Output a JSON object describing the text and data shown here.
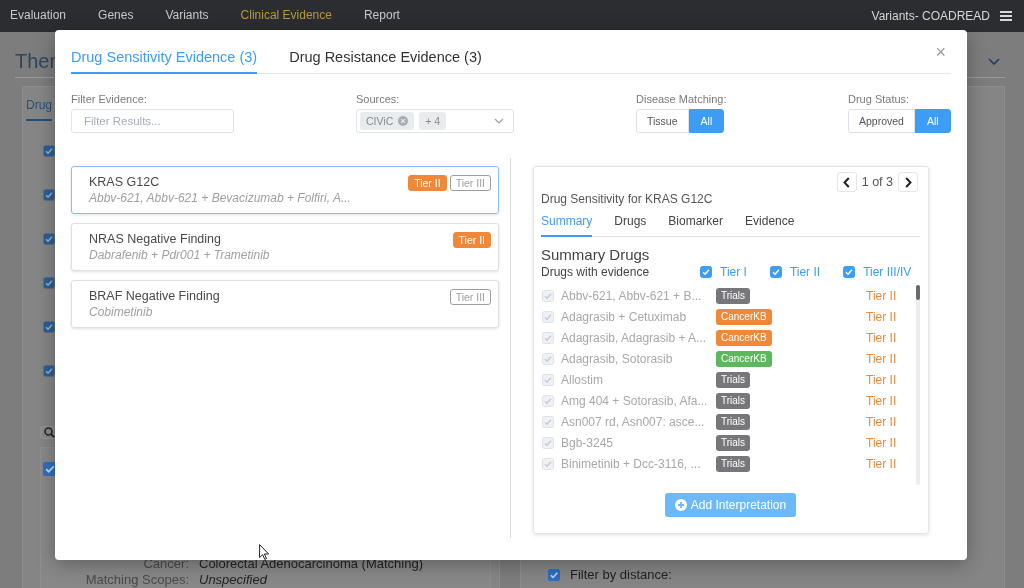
{
  "nav": {
    "items": [
      {
        "label": "Evaluation",
        "selected": false
      },
      {
        "label": "Genes",
        "selected": false
      },
      {
        "label": "Variants",
        "selected": false
      },
      {
        "label": "Clinical Evidence",
        "selected": true
      },
      {
        "label": "Report",
        "selected": false
      }
    ],
    "project": "Variants- COADREAD"
  },
  "page": {
    "title": "Ther",
    "tab": {
      "label": "Drug",
      "selected": true
    },
    "checkboxes": [
      {
        "checked": true
      },
      {
        "checked": true
      },
      {
        "checked": true
      },
      {
        "checked": true
      },
      {
        "checked": true
      },
      {
        "checked": true
      }
    ],
    "panel_checkbox": {
      "checked": true
    },
    "details": [
      {
        "label": "Cancer:",
        "value": "Colorectal Adenocarcinoma (Matching)",
        "kind": "matched"
      },
      {
        "label": "Matching Scopes:",
        "value": "Unspecified",
        "kind": "unspecified"
      }
    ],
    "distance_filter": {
      "label": "Filter by distance:",
      "checked": true
    }
  },
  "modal": {
    "tabs": [
      {
        "label": "Drug Sensitivity Evidence (3)",
        "selected": true
      },
      {
        "label": "Drug Resistance Evidence (3)",
        "selected": false
      }
    ],
    "close": "×",
    "filters": {
      "evidence": {
        "label": "Filter Evidence:",
        "placeholder": "Filter Results..."
      },
      "sources": {
        "label": "Sources:",
        "chips": [
          {
            "label": "CIViC",
            "removable": true
          },
          {
            "label": "+ 4",
            "removable": false
          }
        ]
      },
      "disease_matching": {
        "label": "Disease Matching:",
        "options": [
          {
            "label": "Tissue",
            "selected": false
          },
          {
            "label": "All",
            "selected": true
          }
        ]
      },
      "drug_status": {
        "label": "Drug Status:",
        "options": [
          {
            "label": "Approved",
            "selected": false
          },
          {
            "label": "All",
            "selected": true
          }
        ]
      }
    },
    "variants": [
      {
        "title": "KRAS G12C",
        "drugs": "Abbv-621, Abbv-621 + Bevacizumab + Folfiri, A...",
        "selected": true,
        "tiers": [
          {
            "label": "Tier II",
            "filled": true,
            "color": "#f0883a"
          },
          {
            "label": "Tier III",
            "filled": false,
            "color": "#9e9e9e"
          }
        ]
      },
      {
        "title": "NRAS Negative Finding",
        "drugs": "Dabrafenib + Pdr001 + Trametinib",
        "selected": false,
        "tiers": [
          {
            "label": "Tier II",
            "filled": true,
            "color": "#f0883a"
          }
        ]
      },
      {
        "title": "BRAF Negative Finding",
        "drugs": "Cobimetinib",
        "selected": false,
        "tiers": [
          {
            "label": "Tier III",
            "filled": false,
            "color": "#9e9e9e"
          }
        ]
      }
    ],
    "detail": {
      "pager": "1 of 3",
      "heading": "Drug Sensitivity for KRAS G12C",
      "tabs": [
        {
          "label": "Summary",
          "selected": true
        },
        {
          "label": "Drugs",
          "selected": false
        },
        {
          "label": "Biomarker",
          "selected": false
        },
        {
          "label": "Evidence",
          "selected": false
        }
      ],
      "section_title": "Summary Drugs",
      "subtitle": "Drugs with evidence",
      "tier_filters": [
        {
          "label": "Tier I",
          "checked": true
        },
        {
          "label": "Tier II",
          "checked": true
        },
        {
          "label": "Tier III/IV",
          "checked": true
        }
      ],
      "drugs": [
        {
          "name": "Abbv-621, Abbv-621 + B...",
          "checked": true,
          "disabled": true,
          "source": "Trials",
          "color": "#77777b",
          "tier": "Tier II"
        },
        {
          "name": "Adagrasib + Cetuximab",
          "checked": true,
          "disabled": true,
          "source": "CancerKB",
          "color": "#f0883a",
          "tier": "Tier II"
        },
        {
          "name": "Adagrasib, Adagrasib + A...",
          "checked": true,
          "disabled": true,
          "source": "CancerKB",
          "color": "#f0883a",
          "tier": "Tier II"
        },
        {
          "name": "Adagrasib, Sotorasib",
          "checked": true,
          "disabled": true,
          "source": "CancerKB",
          "color": "#5cb85c",
          "tier": "Tier II"
        },
        {
          "name": "Allostim",
          "checked": true,
          "disabled": true,
          "source": "Trials",
          "color": "#77777b",
          "tier": "Tier II"
        },
        {
          "name": "Amg 404 + Sotorasib, Afa...",
          "checked": true,
          "disabled": true,
          "source": "Trials",
          "color": "#77777b",
          "tier": "Tier II"
        },
        {
          "name": "Asn007 rd, Asn007: asce...",
          "checked": true,
          "disabled": true,
          "source": "Trials",
          "color": "#77777b",
          "tier": "Tier II"
        },
        {
          "name": "Bgb-3245",
          "checked": true,
          "disabled": true,
          "source": "Trials",
          "color": "#77777b",
          "tier": "Tier II"
        },
        {
          "name": "Binimetinib + Dcc-3116, ...",
          "checked": true,
          "disabled": true,
          "source": "Trials",
          "color": "#77777b",
          "tier": "Tier II"
        }
      ],
      "add_button": "Add Interpretation"
    }
  }
}
